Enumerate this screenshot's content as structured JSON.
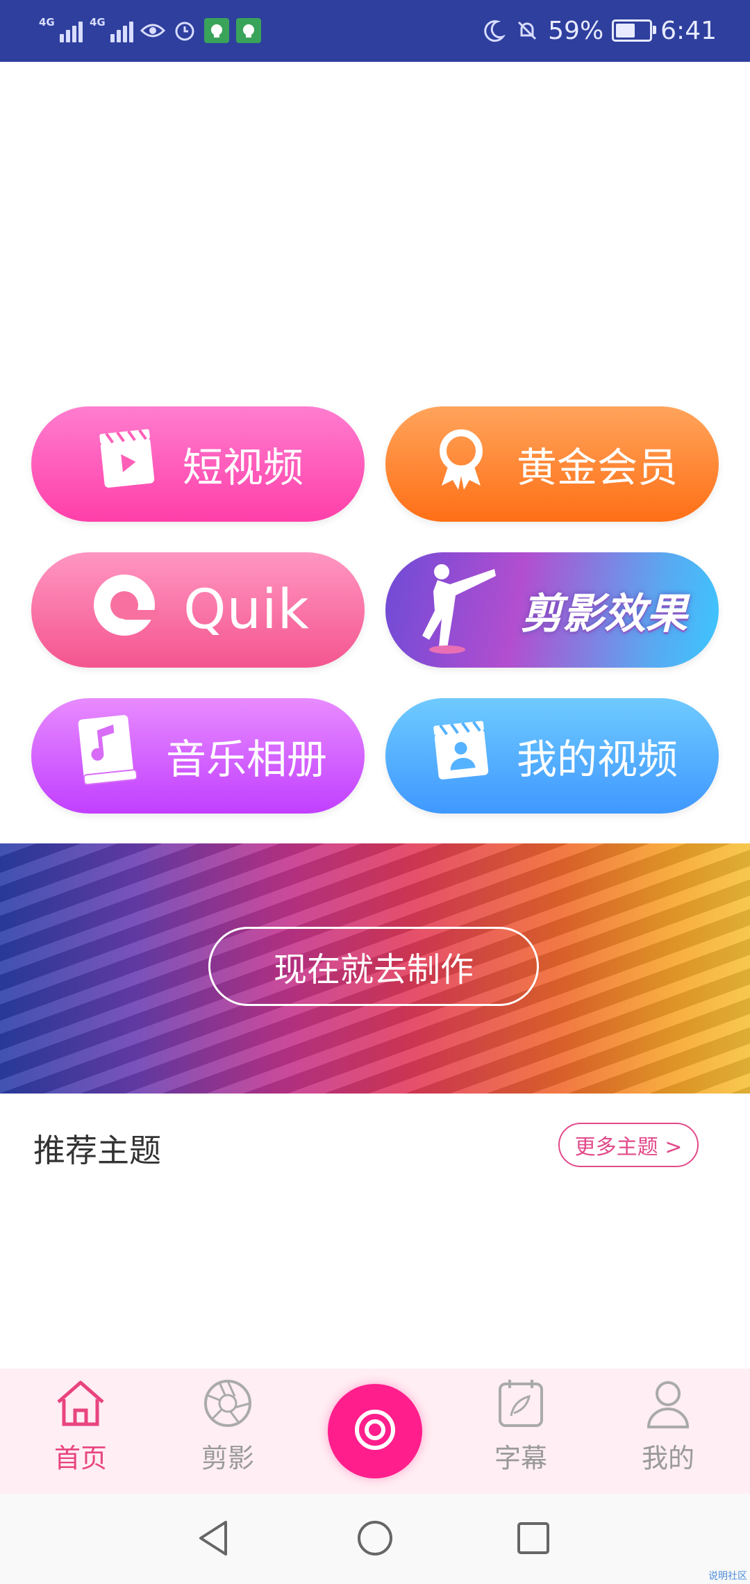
{
  "status_bar": {
    "network_1": "4G",
    "network_2": "4G",
    "battery_percent": "59%",
    "battery_level": 0.59,
    "time": "6:41"
  },
  "actions": {
    "short_video": "短视频",
    "gold_member": "黄金会员",
    "quik": "Quik",
    "editing_effects": "剪影效果",
    "music_album": "音乐相册",
    "my_videos": "我的视频"
  },
  "banner": {
    "cta_label": "现在就去制作"
  },
  "recommended": {
    "title": "推荐主题",
    "more_label": "更多主题 >"
  },
  "tab_bar": {
    "tabs": [
      {
        "label": "首页",
        "icon": "home-icon",
        "active": true
      },
      {
        "label": "剪影",
        "icon": "aperture-icon",
        "active": false
      },
      {
        "label": "",
        "icon": "record-icon",
        "active": false
      },
      {
        "label": "字幕",
        "icon": "caption-icon",
        "active": false
      },
      {
        "label": "我的",
        "icon": "user-icon",
        "active": false
      }
    ]
  },
  "colors": {
    "status_bar": "#2e3f9e",
    "accent": "#e8447f",
    "center_button": "#ff1e8c",
    "tab_bar_bg": "#ffeef3"
  },
  "watermark": "说明社区"
}
